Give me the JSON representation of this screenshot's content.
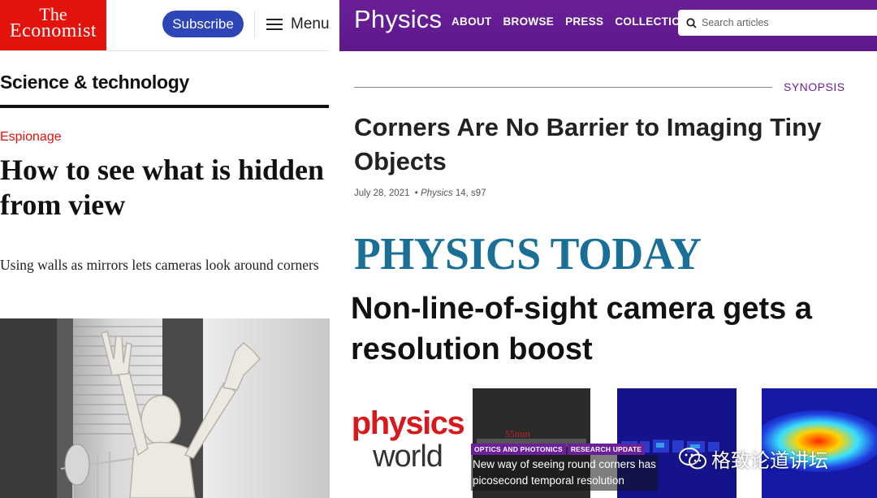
{
  "economist": {
    "logo_line1": "The",
    "logo_line2": "Economist",
    "subscribe_label": "Subscribe",
    "menu_label": "Menu",
    "section": "Science & technology",
    "kicker": "Espionage",
    "headline": "How to see what is hidden from view",
    "dek": "Using walls as mirrors lets cameras look around corners"
  },
  "aps": {
    "logo": "Physics",
    "nav": [
      "ABOUT",
      "BROWSE",
      "PRESS",
      "COLLECTIONS"
    ],
    "search_placeholder": "Search articles",
    "label": "SYNOPSIS",
    "headline": "Corners Are No Barrier to Imaging Tiny Objects",
    "date": "July 28, 2021",
    "journal": "Physics",
    "citation": "14, s97"
  },
  "physics_today": {
    "masthead": "PHYSICS TODAY",
    "headline": "Non-line-of-sight camera gets a resolution boost"
  },
  "physics_world": {
    "logo_line1": "physics",
    "logo_line2": "world",
    "tags": [
      "OPTICS AND PHOTONICS",
      "RESEARCH UPDATE"
    ],
    "caption": "New way of seeing round corners has picosecond temporal resolution",
    "thumb_label": "55mm"
  },
  "watermark": "格致论道讲坛",
  "colors": {
    "economist_red": "#e3120b",
    "subscribe_blue": "#2e45b8",
    "aps_purple": "#6b1f98",
    "physics_today_blue": "#1a6f96",
    "physics_world_red": "#d7191e"
  }
}
